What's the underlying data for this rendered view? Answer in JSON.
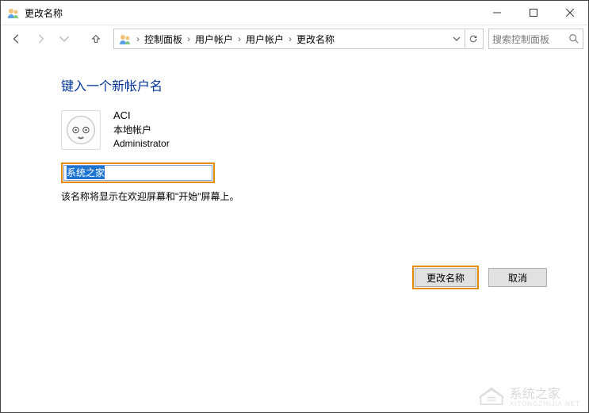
{
  "window": {
    "title": "更改名称"
  },
  "nav": {
    "breadcrumbs": [
      "控制面板",
      "用户帐户",
      "用户帐户",
      "更改名称"
    ],
    "search_placeholder": "搜索控制面板"
  },
  "content": {
    "heading": "键入一个新帐户名",
    "user": {
      "name": "ACI",
      "type": "本地帐户",
      "role": "Administrator"
    },
    "input_value": "系统之家",
    "hint": "该名称将显示在欢迎屏幕和\"开始\"屏幕上。"
  },
  "buttons": {
    "change": "更改名称",
    "cancel": "取消"
  },
  "watermark": {
    "text": "系统之家",
    "sub": "XITONGZHIJIA.NET"
  }
}
